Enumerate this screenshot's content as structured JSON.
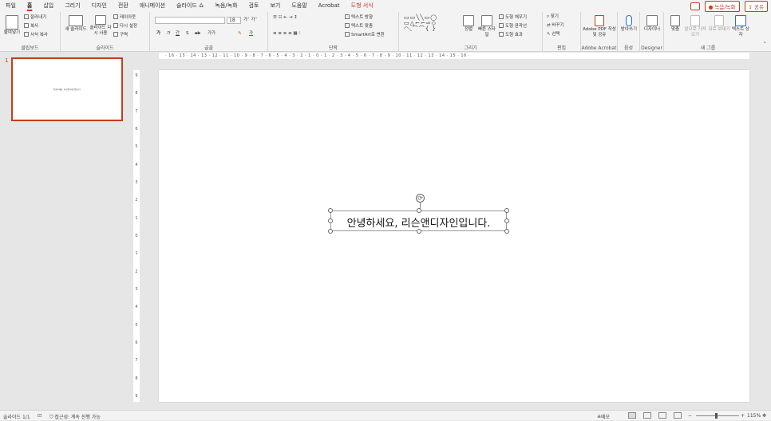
{
  "tabs": [
    "파일",
    "홈",
    "삽입",
    "그리기",
    "디자인",
    "전환",
    "애니메이션",
    "슬라이드 쇼",
    "녹음/녹화",
    "검토",
    "보기",
    "도움말",
    "Acrobat",
    "도형 서식"
  ],
  "active_tab": "홈",
  "record_button": "녹음/녹화",
  "share_button": "공유",
  "ribbon": {
    "clipboard": {
      "label": "클립보드",
      "paste": "붙여넣기",
      "cut": "잘라내기",
      "copy": "복사",
      "format_painter": "서식 복사"
    },
    "slides": {
      "label": "슬라이드",
      "new_slide": "새 슬라이드",
      "reuse": "슬라이드 다시 사용",
      "layout": "레이아웃",
      "reset": "다시 설정",
      "section": "구역"
    },
    "font": {
      "label": "글꼴",
      "font_name": "",
      "font_size": "18",
      "bold": "가",
      "italic": "가",
      "underline": "간",
      "strike": "S",
      "spacing": "ab",
      "case": "가가",
      "color_a": "가"
    },
    "paragraph": {
      "label": "단락",
      "text_direction": "텍스트 방향",
      "align_text": "텍스트 맞춤",
      "smartart": "SmartArt로 변환"
    },
    "drawing": {
      "label": "그리기",
      "arrange": "정렬",
      "quick_styles": "빠른 스타일",
      "fill": "도형 채우기",
      "outline": "도형 윤곽선",
      "effects": "도형 효과"
    },
    "editing": {
      "label": "편집",
      "find": "찾기",
      "replace": "바꾸기",
      "select": "선택"
    },
    "acrobat": {
      "label": "Adobe Acrobat",
      "button": "Adobe PDF 작성 및 공유"
    },
    "voice": {
      "label": "음성",
      "button": "받아쓰기"
    },
    "designer": {
      "label": "Designer",
      "button": "디자이너"
    },
    "group": {
      "label": "새 그룹",
      "align": "맞춤",
      "bring_forward": "앞으로 가져오기",
      "send_backward": "뒤로 보내기",
      "textbox": "텍스트 상자"
    }
  },
  "ruler_h": "· 16 · 15 · 14 · 13 · 12 · 11 · 10 · 9 · 8 · 7 · 6 · 5 · 4 · 3 · 2 · 1 · 0 · 1 · 2 · 3 · 4 · 5 · 6 · 7 · 8 · 9 · 10 · 11 · 12 · 13 · 14 · 15 · 16 ·",
  "ruler_v": [
    "9",
    "8",
    "7",
    "6",
    "5",
    "4",
    "3",
    "2",
    "1",
    "0",
    "1",
    "2",
    "3",
    "4",
    "5",
    "6",
    "7",
    "8",
    "9"
  ],
  "slide_number": "1",
  "thumb_text": "안녕하세요, 리슨앤디자인입니다.",
  "slide_text": "안녕하세요, 리슨앤디자인입니다.",
  "status": {
    "slide_count": "슬라이드 1/1",
    "accessibility": "접근성: 계속 진행 가능",
    "notes": "메모",
    "zoom": "115%"
  }
}
